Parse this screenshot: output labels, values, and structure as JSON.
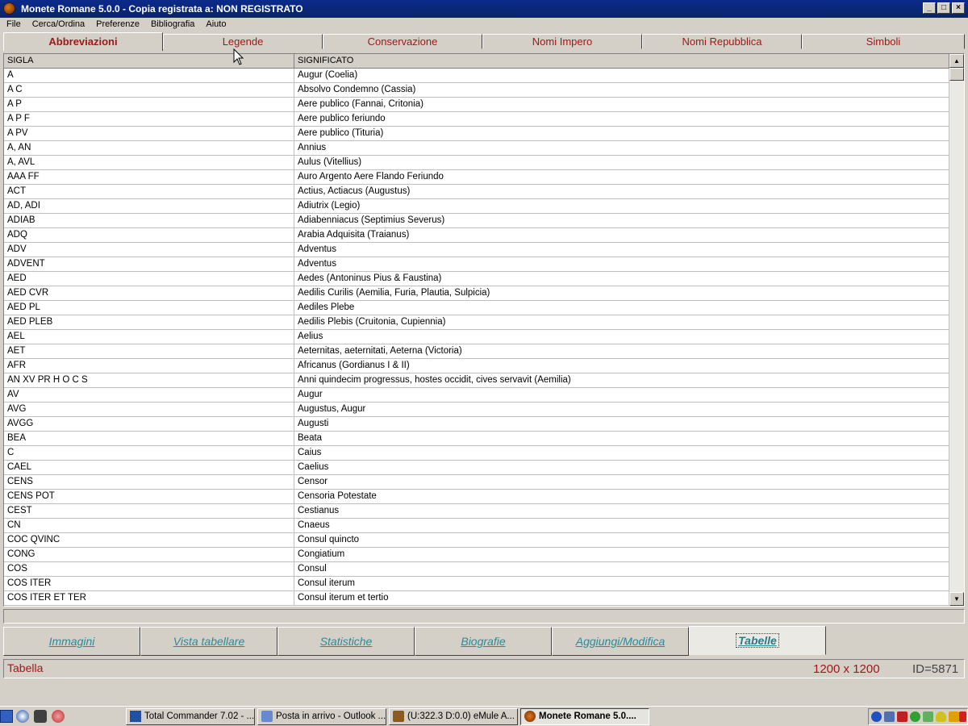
{
  "window": {
    "title": "Monete Romane 5.0.0 - Copia registrata a:  NON REGISTRATO"
  },
  "menu": [
    "File",
    "Cerca/Ordina",
    "Preferenze",
    "Bibliografia",
    "Aiuto"
  ],
  "top_tabs": [
    "Abbreviazioni",
    "Legende",
    "Conservazione",
    "Nomi Impero",
    "Nomi Repubblica",
    "Simboli"
  ],
  "table": {
    "headers": [
      "SIGLA",
      "SIGNIFICATO"
    ],
    "rows": [
      [
        "A",
        "Augur (Coelia)"
      ],
      [
        "A C",
        "Absolvo Condemno (Cassia)"
      ],
      [
        "A P",
        "Aere publico (Fannai, Critonia)"
      ],
      [
        "A P F",
        "Aere publico feriundo"
      ],
      [
        "A PV",
        "Aere publico (Tituria)"
      ],
      [
        "A, AN",
        "Annius"
      ],
      [
        "A, AVL",
        "Aulus (Vitellius)"
      ],
      [
        "AAA FF",
        "Auro Argento Aere Flando Feriundo"
      ],
      [
        "ACT",
        "Actius, Actiacus (Augustus)"
      ],
      [
        "AD, ADI",
        "Adiutrix (Legio)"
      ],
      [
        "ADIAB",
        "Adiabenniacus (Septimius Severus)"
      ],
      [
        "ADQ",
        "Arabia Adquisita (Traianus)"
      ],
      [
        "ADV",
        "Adventus"
      ],
      [
        "ADVENT",
        "Adventus"
      ],
      [
        "AED",
        "Aedes (Antoninus Pius & Faustina)"
      ],
      [
        "AED CVR",
        "Aedilis Curilis (Aemilia, Furia, Plautia, Sulpicia)"
      ],
      [
        "AED PL",
        "Aediles Plebe"
      ],
      [
        "AED PLEB",
        "Aedilis Plebis (Cruitonia, Cupiennia)"
      ],
      [
        "AEL",
        "Aelius"
      ],
      [
        "AET",
        "Aeternitas, aeternitati, Aeterna (Victoria)"
      ],
      [
        "AFR",
        "Africanus (Gordianus I & II)"
      ],
      [
        "AN XV PR H O C S",
        "Anni quindecim progressus, hostes occidit, cives servavit (Aemilia)"
      ],
      [
        "AV",
        "Augur"
      ],
      [
        "AVG",
        "Augustus, Augur"
      ],
      [
        "AVGG",
        "Augusti"
      ],
      [
        "BEA",
        "Beata"
      ],
      [
        "C",
        "Caius"
      ],
      [
        "CAEL",
        "Caelius"
      ],
      [
        "CENS",
        "Censor"
      ],
      [
        "CENS POT",
        "Censoria Potestate"
      ],
      [
        "CEST",
        "Cestianus"
      ],
      [
        "CN",
        "Cnaeus"
      ],
      [
        "COC QVINC",
        "Consul quincto"
      ],
      [
        "CONG",
        "Congiatium"
      ],
      [
        "COS",
        "Consul"
      ],
      [
        "COS ITER",
        "Consul iterum"
      ],
      [
        "COS ITER ET TER",
        "Consul iterum et tertio"
      ]
    ]
  },
  "bottom_tabs": [
    "Immagini",
    "Vista tabellare",
    "Statistiche",
    "Biografie",
    "Aggiungi/Modifica",
    "Tabelle"
  ],
  "status": {
    "label": "Tabella",
    "size": "1200 x 1200",
    "id": "ID=5871"
  },
  "taskbar": {
    "tasks": [
      "Total Commander 7.02 - ...",
      "Posta in arrivo - Outlook ...",
      "(U:322.3 D:0.0) eMule A...",
      "Monete Romane 5.0...."
    ]
  },
  "colors": {
    "title_bar": "#0a246a",
    "tab_text": "#a01818",
    "link": "#2a8a9a"
  }
}
